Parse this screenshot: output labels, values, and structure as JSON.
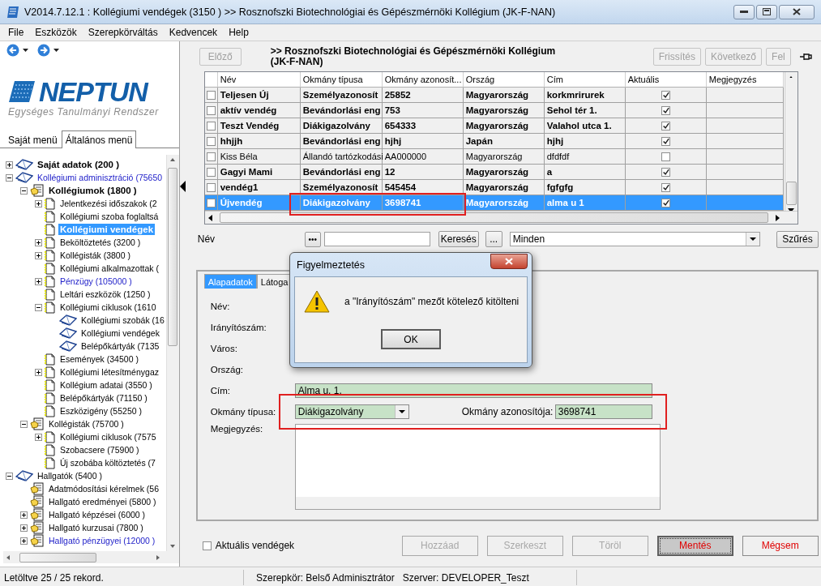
{
  "window": {
    "title": "V2014.7.12.1 : Kollégiumi vendégek (3150  )  >> Rosznofszki Biotechnológiai és Gépészmérnöki Kollégium (JK-F-NAN)"
  },
  "menu": [
    "File",
    "Eszközök",
    "Szerepkörváltás",
    "Kedvencek",
    "Help"
  ],
  "logo": {
    "name": "NEPTUN",
    "tagline": "Egységes Tanulmányi Rendszer"
  },
  "menu_tabs": [
    {
      "label": "Saját menü",
      "selected": false
    },
    {
      "label": "Általános menü",
      "selected": true
    }
  ],
  "tree": [
    {
      "label": "Saját adatok (200  )",
      "kind": "book",
      "bold": true,
      "selected": false,
      "linked": false,
      "expanded": false
    },
    {
      "label": "Kollégiumi adminisztráció (75650",
      "kind": "book",
      "bold": false,
      "selected": false,
      "linked": true,
      "expanded": true,
      "children": [
        {
          "label": "Kollégiumok (1800  )",
          "kind": "folder",
          "bold": true,
          "selected": false,
          "linked": false,
          "expanded": true,
          "children": [
            {
              "label": "Jelentkezési időszakok (2",
              "kind": "page",
              "bold": false,
              "selected": false,
              "linked": false,
              "expanded": false
            },
            {
              "label": "Kollégiumi szoba foglaltsá",
              "kind": "page",
              "bold": false,
              "selected": false,
              "linked": false
            },
            {
              "label": "Kollégiumi vendégek",
              "kind": "page",
              "bold": true,
              "selected": true,
              "linked": false
            },
            {
              "label": "Beköltöztetés (3200  )",
              "kind": "page",
              "bold": false,
              "selected": false,
              "linked": false,
              "expanded": false
            },
            {
              "label": "Kollégisták (3800  )",
              "kind": "page",
              "bold": false,
              "selected": false,
              "linked": false,
              "expanded": false
            },
            {
              "label": "Kollégiumi alkalmazottak (",
              "kind": "page",
              "bold": false,
              "selected": false,
              "linked": false
            },
            {
              "label": "Pénzügy (105000  )",
              "kind": "page",
              "bold": false,
              "selected": false,
              "linked": true,
              "expanded": false
            },
            {
              "label": "Leltári eszközök (1250  )",
              "kind": "page",
              "bold": false,
              "selected": false,
              "linked": false
            },
            {
              "label": "Kollégiumi ciklusok (1610",
              "kind": "page",
              "bold": false,
              "selected": false,
              "linked": false,
              "expanded": true,
              "children": [
                {
                  "label": "Kollégiumi szobák (16",
                  "kind": "book",
                  "bold": false,
                  "selected": false,
                  "linked": false
                },
                {
                  "label": "Kollégiumi vendégek",
                  "kind": "book",
                  "bold": false,
                  "selected": false,
                  "linked": false
                },
                {
                  "label": "Belépőkártyák (7135",
                  "kind": "book",
                  "bold": false,
                  "selected": false,
                  "linked": false
                }
              ]
            },
            {
              "label": "Események (34500  )",
              "kind": "page",
              "bold": false,
              "selected": false,
              "linked": false
            },
            {
              "label": "Kollégiumi létesítménygaz",
              "kind": "page",
              "bold": false,
              "selected": false,
              "linked": false,
              "expanded": false
            },
            {
              "label": "Kollégium adatai (3550  )",
              "kind": "page",
              "bold": false,
              "selected": false,
              "linked": false
            },
            {
              "label": "Belépőkártyák (71150  )",
              "kind": "page",
              "bold": false,
              "selected": false,
              "linked": false
            },
            {
              "label": "Eszközigény (55250  )",
              "kind": "page",
              "bold": false,
              "selected": false,
              "linked": false
            }
          ]
        },
        {
          "label": "Kollégisták (75700  )",
          "kind": "folder",
          "bold": false,
          "selected": false,
          "linked": false,
          "expanded": true,
          "children": [
            {
              "label": "Kollégiumi ciklusok (7575",
              "kind": "page",
              "bold": false,
              "selected": false,
              "linked": false,
              "expanded": false
            },
            {
              "label": "Szobacsere (75900  )",
              "kind": "page",
              "bold": false,
              "selected": false,
              "linked": false
            },
            {
              "label": "Új szobába költöztetés (7",
              "kind": "page",
              "bold": false,
              "selected": false,
              "linked": false
            }
          ]
        }
      ]
    },
    {
      "label": "Hallgatók (5400  )",
      "kind": "book",
      "bold": false,
      "selected": false,
      "linked": false,
      "expanded": true,
      "children": [
        {
          "label": "Adatmódosítási kérelmek (56",
          "kind": "folder",
          "bold": false,
          "selected": false,
          "linked": false
        },
        {
          "label": "Hallgató eredményei (5800  )",
          "kind": "folder",
          "bold": false,
          "selected": false,
          "linked": false
        },
        {
          "label": "Hallgató képzései (6000  )",
          "kind": "folder",
          "bold": false,
          "selected": false,
          "linked": false,
          "expanded": false
        },
        {
          "label": "Hallgató kurzusai (7800  )",
          "kind": "folder",
          "bold": false,
          "selected": false,
          "linked": false,
          "expanded": false
        },
        {
          "label": "Hallgató pénzügyei (12000  )",
          "kind": "folder",
          "bold": false,
          "selected": false,
          "linked": true,
          "expanded": false
        }
      ]
    }
  ],
  "header": {
    "prev_button": {
      "label": "Előző",
      "disabled": true
    },
    "title": ">> Rosznofszki Biotechnológiai és Gépészmérnöki Kollégium (JK-F-NAN)",
    "buttons": [
      {
        "label": "Frissítés",
        "disabled": true
      },
      {
        "label": "Következő",
        "disabled": true
      },
      {
        "label": "Fel",
        "disabled": true
      }
    ]
  },
  "table": {
    "columns": [
      "Név",
      "Okmány típusa",
      "Okmány azonosít...",
      "Ország",
      "Cím",
      "Aktuális",
      "Megjegyzés"
    ],
    "rows": [
      {
        "cells": [
          "Teljesen Új",
          "Személyazonosít",
          "25852",
          "Magyarország",
          "korkmrirurek"
        ],
        "aktualis": true,
        "bold": true,
        "checked": false,
        "selected": false
      },
      {
        "cells": [
          "aktív vendég",
          "Bevándorlási eng",
          "753",
          "Magyarország",
          "Sehol tér 1."
        ],
        "aktualis": true,
        "bold": true,
        "checked": false,
        "selected": false
      },
      {
        "cells": [
          "Teszt Vendég",
          "Diákigazolvány",
          "654333",
          "Magyarország",
          "Valahol utca 1."
        ],
        "aktualis": true,
        "bold": true,
        "checked": false,
        "selected": false
      },
      {
        "cells": [
          "hhjjh",
          "Bevándorlási eng",
          "hjhj",
          "Japán",
          "hjhj"
        ],
        "aktualis": true,
        "bold": true,
        "checked": false,
        "selected": false
      },
      {
        "cells": [
          "Kiss Béla",
          "Állandó tartózkodási",
          "AA000000",
          "Magyarország",
          "dfdfdf"
        ],
        "aktualis": false,
        "bold": false,
        "checked": false,
        "selected": false
      },
      {
        "cells": [
          "Gagyi Mami",
          "Bevándorlási eng",
          "12",
          "Magyarország",
          "a"
        ],
        "aktualis": true,
        "bold": true,
        "checked": false,
        "selected": false
      },
      {
        "cells": [
          "vendég1",
          "Személyazonosít",
          "545454",
          "Magyarország",
          "fgfgfg"
        ],
        "aktualis": true,
        "bold": true,
        "checked": false,
        "selected": false
      },
      {
        "cells": [
          "Újvendég",
          "Diákigazolvány",
          "3698741",
          "Magyarország",
          "alma u 1"
        ],
        "aktualis": true,
        "bold": true,
        "checked": false,
        "selected": true
      }
    ]
  },
  "search": {
    "label": "Név",
    "dots_button": "•••",
    "search_button": "Keresés",
    "more_button": "...",
    "filter": "Minden",
    "filter_button": "Szűrés"
  },
  "detail_tabs": [
    {
      "label": "Alapadatok",
      "selected": true
    },
    {
      "label": "Látoga",
      "selected": false
    }
  ],
  "form": [
    {
      "kind": "label",
      "label": "Név:"
    },
    {
      "kind": "label",
      "label": "Irányítószám:"
    },
    {
      "kind": "label",
      "label": "Város:"
    },
    {
      "kind": "label",
      "label": "Ország:"
    },
    {
      "kind": "text",
      "label": "Cím:",
      "value": "Alma u. 1."
    },
    {
      "kind": "combo",
      "label": "Okmány típusa:",
      "value": "Diákigazolvány",
      "extra_label": "Okmány azonosítója:",
      "extra_value": "3698741"
    },
    {
      "kind": "textarea",
      "label": "Megjegyzés:"
    }
  ],
  "dialog": {
    "title": "Figyelmeztetés",
    "message": "a \"Irányítószám\" mezőt kötelező kitölteni",
    "button": "OK"
  },
  "bottom": {
    "checkbox": {
      "label": "Aktuális vendégek",
      "checked": false
    },
    "buttons": [
      {
        "label": "Hozzáad",
        "disabled": true,
        "kind": "normal",
        "focused": false
      },
      {
        "label": "Szerkeszt",
        "disabled": true,
        "kind": "normal",
        "focused": false
      },
      {
        "label": "Töröl",
        "disabled": true,
        "kind": "normal",
        "focused": false
      },
      {
        "label": "Mentés",
        "disabled": false,
        "kind": "warn",
        "focused": true
      },
      {
        "label": "Mégsem",
        "disabled": false,
        "kind": "warn",
        "focused": false
      }
    ]
  },
  "status_bar": [
    "Letöltve 25 / 25 rekord.",
    "Szerepkör: Belső Adminisztrátor",
    "Szerver: DEVELOPER_Teszt"
  ]
}
